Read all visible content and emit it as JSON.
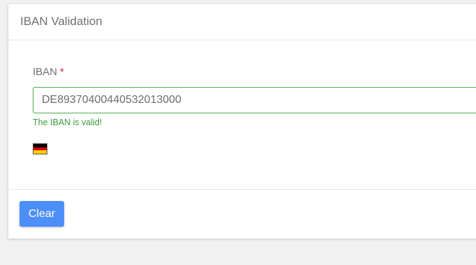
{
  "card": {
    "title": "IBAN Validation"
  },
  "form": {
    "label": "IBAN",
    "required_marker": "*",
    "iban_value": "DE89370400440532013000",
    "validation_message": "The IBAN is valid!",
    "country_flag": {
      "icon": "germany-flag-icon",
      "colors": [
        "#000000",
        "#dd0000",
        "#ffce00"
      ]
    }
  },
  "footer": {
    "clear_label": "Clear"
  },
  "colors": {
    "accent": "#4d8ff8",
    "valid": "#3c9a3c",
    "required": "#c9302c"
  }
}
